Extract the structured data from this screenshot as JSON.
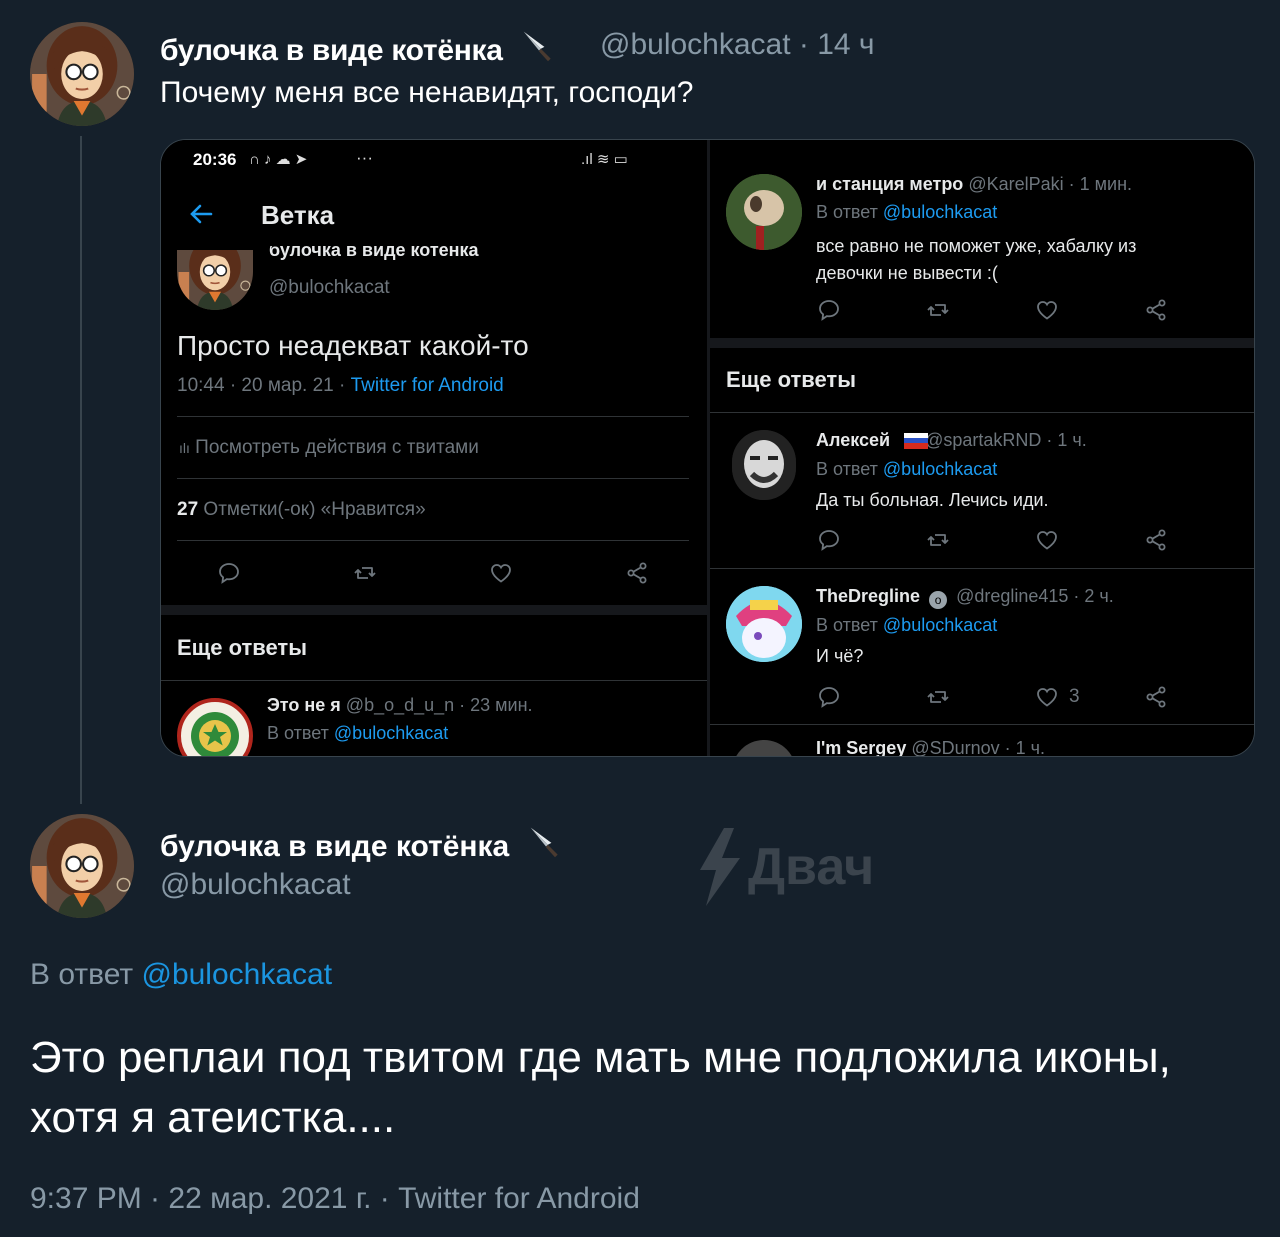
{
  "tweet1": {
    "author_name": "булочка в виде котёнка",
    "meta": "@bulochkacat · 14 ч",
    "text": "Почему меня все ненавидят, господи?"
  },
  "screenshot": {
    "left": {
      "status_time": "20:36",
      "status_more": "···",
      "header_title": "Ветка",
      "author_name": "булочка в виде котёнка",
      "author_handle": "@bulochkacat",
      "tweet_text": "Просто неадекват какой-то",
      "timestamp": "10:44 · 20 мар. 21 ·",
      "source": "Twitter for Android",
      "activity_label": "Посмотреть действия с твитами",
      "likes_count": "27",
      "likes_label": "Отметки(-ок) «Нравится»",
      "more_replies": "Еще ответы",
      "reply_name": "Это не я",
      "reply_meta": "@b_o_d_u_n · 23 мин.",
      "reply_to_label": "В ответ",
      "reply_to_handle": "@bulochkacat"
    },
    "right": {
      "reply1": {
        "name": "и станция метро",
        "meta": "@KarelPaki · 1 мин.",
        "reply_to_label": "В ответ",
        "reply_to_handle": "@bulochkacat",
        "text_line1": "все равно не поможет уже, хабалку из",
        "text_line2": "девочки не вывести :("
      },
      "more_replies": "Еще ответы",
      "reply2": {
        "name": "Алексей",
        "meta": "@spartakRND · 1 ч.",
        "reply_to_label": "В ответ",
        "reply_to_handle": "@bulochkacat",
        "text": "Да ты больная. Лечись иди."
      },
      "reply3": {
        "name": "TheDregline",
        "meta": "@dregline415 · 2 ч.",
        "reply_to_label": "В ответ",
        "reply_to_handle": "@bulochkacat",
        "text": "И чё?",
        "like_count": "3"
      },
      "reply4": {
        "name": "I'm Sergey",
        "meta": "@SDurnov · 1 ч."
      }
    }
  },
  "tweet2": {
    "author_name": "булочка в виде котёнка",
    "handle": "@bulochkacat",
    "reply_to_label": "В ответ",
    "reply_to_handle": "@bulochkacat",
    "text": "Это реплаи под твитом где мать мне подложила иконы, хотя я атеистка....",
    "footer": "9:37 PM · 22 мар. 2021 г. · Twitter for Android"
  },
  "watermark": {
    "text": "Двач"
  },
  "colors": {
    "background": "#15202b",
    "muted": "#8899a6",
    "link": "#1b95e0",
    "screenshot_bg": "#000000"
  },
  "icons": [
    "knife-icon",
    "back-arrow-icon",
    "reply-icon",
    "retweet-icon",
    "like-icon",
    "share-icon",
    "bar-chart-icon",
    "russia-flag-icon",
    "verified-badge-icon",
    "lightning-icon"
  ]
}
